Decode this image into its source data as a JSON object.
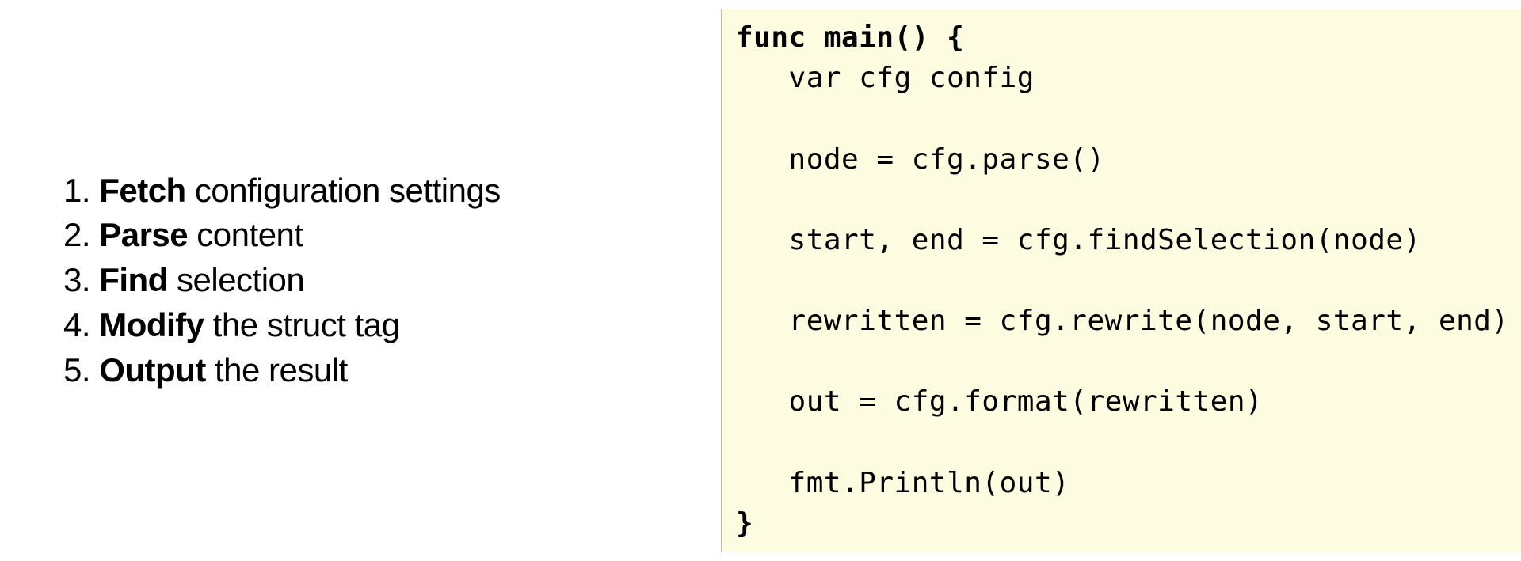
{
  "steps": [
    {
      "keyword": "Fetch",
      "rest": " configuration settings"
    },
    {
      "keyword": "Parse",
      "rest": " content"
    },
    {
      "keyword": "Find",
      "rest": " selection"
    },
    {
      "keyword": "Modify",
      "rest": " the struct tag"
    },
    {
      "keyword": "Output",
      "rest": " the result"
    }
  ],
  "code": {
    "open": "func main() {",
    "l1": "   var cfg config",
    "blank": "",
    "l2": "   node = cfg.parse()",
    "l3": "   start, end = cfg.findSelection(node)",
    "l4": "   rewritten = cfg.rewrite(node, start, end)",
    "l5": "   out = cfg.format(rewritten)",
    "l6": "   fmt.Println(out)",
    "close": "}"
  }
}
